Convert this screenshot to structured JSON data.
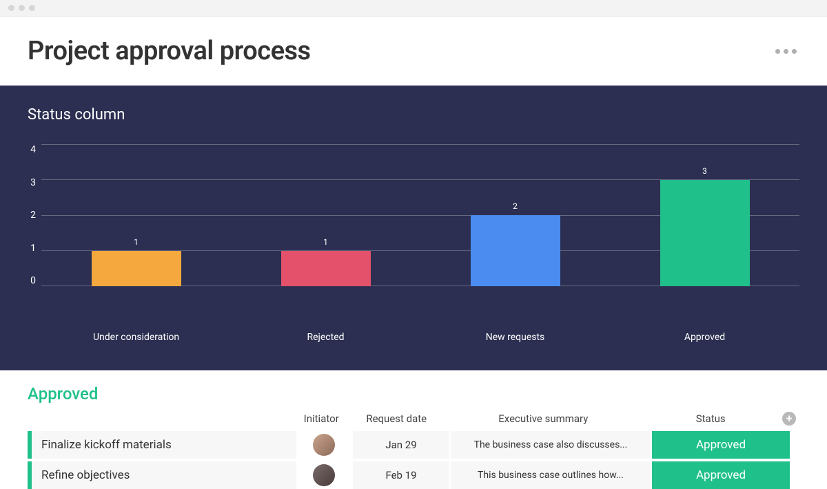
{
  "page": {
    "title": "Project approval process"
  },
  "chart": {
    "title": "Status column"
  },
  "chart_data": {
    "type": "bar",
    "categories": [
      "Under consideration",
      "Rejected",
      "New requests",
      "Approved"
    ],
    "values": [
      1,
      1,
      2,
      3
    ],
    "colors": [
      "#f5a83d",
      "#e3526a",
      "#4a8cf0",
      "#1fc08a"
    ],
    "ylim": [
      0,
      4
    ],
    "yticks": [
      0,
      1,
      2,
      3,
      4
    ]
  },
  "table": {
    "group_title": "Approved",
    "columns": {
      "initiator": "Initiator",
      "request_date": "Request date",
      "summary": "Executive summary",
      "status": "Status"
    },
    "rows": [
      {
        "task": "Finalize kickoff materials",
        "date": "Jan 29",
        "summary": "The business case also discusses...",
        "status": "Approved"
      },
      {
        "task": "Refine objectives",
        "date": "Feb 19",
        "summary": "This business case outlines how...",
        "status": "Approved"
      }
    ]
  }
}
